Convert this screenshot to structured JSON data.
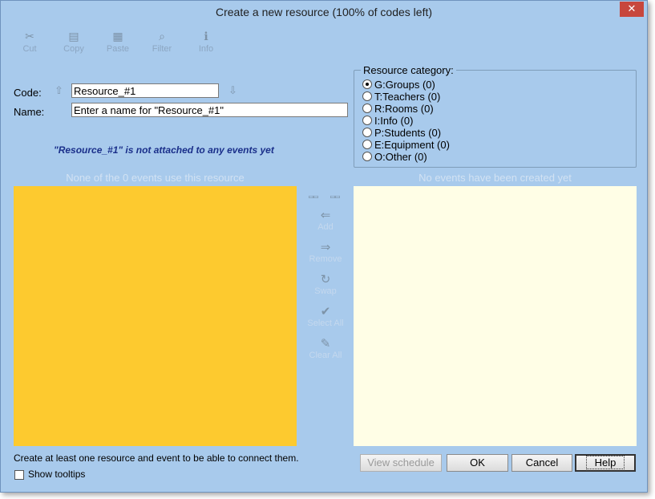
{
  "window": {
    "title": "Create a new resource (100% of codes left)",
    "close_glyph": "✕"
  },
  "toolbar": {
    "items": [
      {
        "label": "Cut",
        "icon": "cut-icon",
        "glyph": "✂"
      },
      {
        "label": "Copy",
        "icon": "copy-icon",
        "glyph": "▤"
      },
      {
        "label": "Paste",
        "icon": "paste-icon",
        "glyph": "▦"
      },
      {
        "label": "Filter",
        "icon": "filter-icon",
        "glyph": "⌕"
      },
      {
        "label": "Info",
        "icon": "info-icon",
        "glyph": "ℹ"
      }
    ]
  },
  "form": {
    "code_label": "Code:",
    "code_value": "Resource_#1",
    "name_label": "Name:",
    "name_value": "Enter a name for \"Resource_#1\"",
    "up_glyph": "⇧",
    "down_glyph": "⇩",
    "notice": "\"Resource_#1\" is not attached to any events yet"
  },
  "category": {
    "legend": "Resource category:",
    "options": [
      {
        "label": "G:Groups (0)",
        "checked": true
      },
      {
        "label": "T:Teachers (0)",
        "checked": false
      },
      {
        "label": "R:Rooms (0)",
        "checked": false
      },
      {
        "label": "I:Info (0)",
        "checked": false
      },
      {
        "label": "P:Students (0)",
        "checked": false
      },
      {
        "label": "E:Equipment (0)",
        "checked": false
      },
      {
        "label": "O:Other (0)",
        "checked": false
      }
    ]
  },
  "lists": {
    "left_caption": "None of the 0 events use this resource",
    "right_caption": "No events have been created yet"
  },
  "middle": {
    "mini_glyph": "▭▭",
    "buttons": [
      {
        "label": "Add",
        "icon": "add-icon",
        "glyph": "⇐"
      },
      {
        "label": "Remove",
        "icon": "remove-icon",
        "glyph": "⇒"
      },
      {
        "label": "Swap",
        "icon": "swap-icon",
        "glyph": "↻"
      },
      {
        "label": "Select All",
        "icon": "select-all-icon",
        "glyph": "✔"
      },
      {
        "label": "Clear All",
        "icon": "clear-all-icon",
        "glyph": "✎"
      }
    ]
  },
  "footer": {
    "note": "Create at least one resource and event to be able to connect them.",
    "tooltips_label": "Show tooltips",
    "view_schedule": "View schedule",
    "ok": "OK",
    "cancel": "Cancel",
    "help": "Help"
  },
  "colors": {
    "background": "#a8caec",
    "left_list": "#fdca2f",
    "right_list": "#fffee6",
    "notice": "#1a2f8a"
  }
}
